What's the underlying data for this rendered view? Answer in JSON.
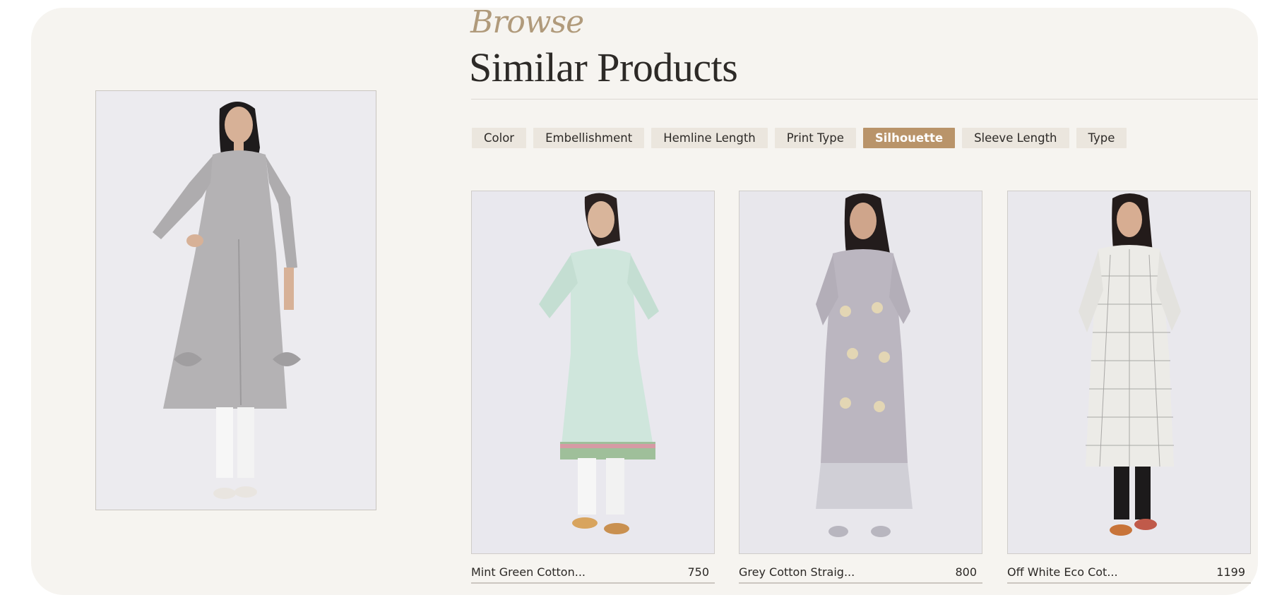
{
  "header": {
    "script_label": "Browse",
    "title": "Similar Products"
  },
  "filters": [
    {
      "label": "Color",
      "active": false
    },
    {
      "label": "Embellishment",
      "active": false
    },
    {
      "label": "Hemline Length",
      "active": false
    },
    {
      "label": "Print Type",
      "active": false
    },
    {
      "label": "Silhouette",
      "active": true
    },
    {
      "label": "Sleeve Length",
      "active": false
    },
    {
      "label": "Type",
      "active": false
    }
  ],
  "products": [
    {
      "name": "Mint Green Cotton...",
      "price": "750"
    },
    {
      "name": "Grey Cotton Straig...",
      "price": "800"
    },
    {
      "name": "Off White Eco Cot...",
      "price": "1199"
    }
  ],
  "colors": {
    "panel_bg": "#f6f4f0",
    "accent": "#b9946a",
    "chip_bg": "#ebe6de",
    "script_text": "#b09a7b"
  }
}
